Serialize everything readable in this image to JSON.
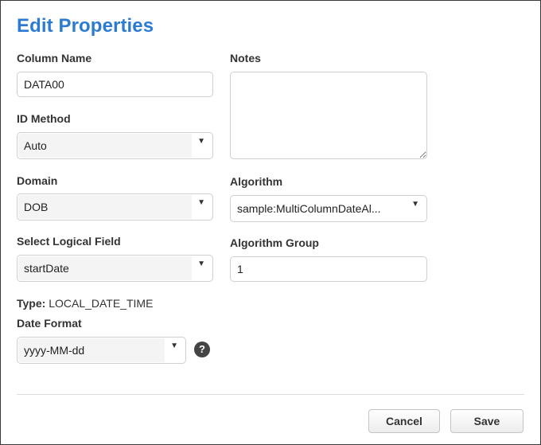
{
  "dialog": {
    "title": "Edit Properties",
    "column_name": {
      "label": "Column Name",
      "value": "DATA00"
    },
    "notes": {
      "label": "Notes",
      "value": ""
    },
    "id_method": {
      "label": "ID Method",
      "selected": "Auto"
    },
    "domain": {
      "label": "Domain",
      "selected": "DOB"
    },
    "algorithm": {
      "label": "Algorithm",
      "selected": "sample:MultiColumnDateAl..."
    },
    "logical_field": {
      "label": "Select Logical Field",
      "selected": "startDate"
    },
    "algorithm_group": {
      "label": "Algorithm Group",
      "value": "1"
    },
    "type": {
      "label": "Type:",
      "value": "LOCAL_DATE_TIME"
    },
    "date_format": {
      "label": "Date Format",
      "selected": "yyyy-MM-dd"
    },
    "help_icon": "question-circle-icon",
    "help_glyph": "?",
    "caret_glyph": "▼",
    "buttons": {
      "cancel": "Cancel",
      "save": "Save"
    },
    "colors": {
      "title": "#2b7bd2",
      "border": "#3a3a3a"
    }
  }
}
